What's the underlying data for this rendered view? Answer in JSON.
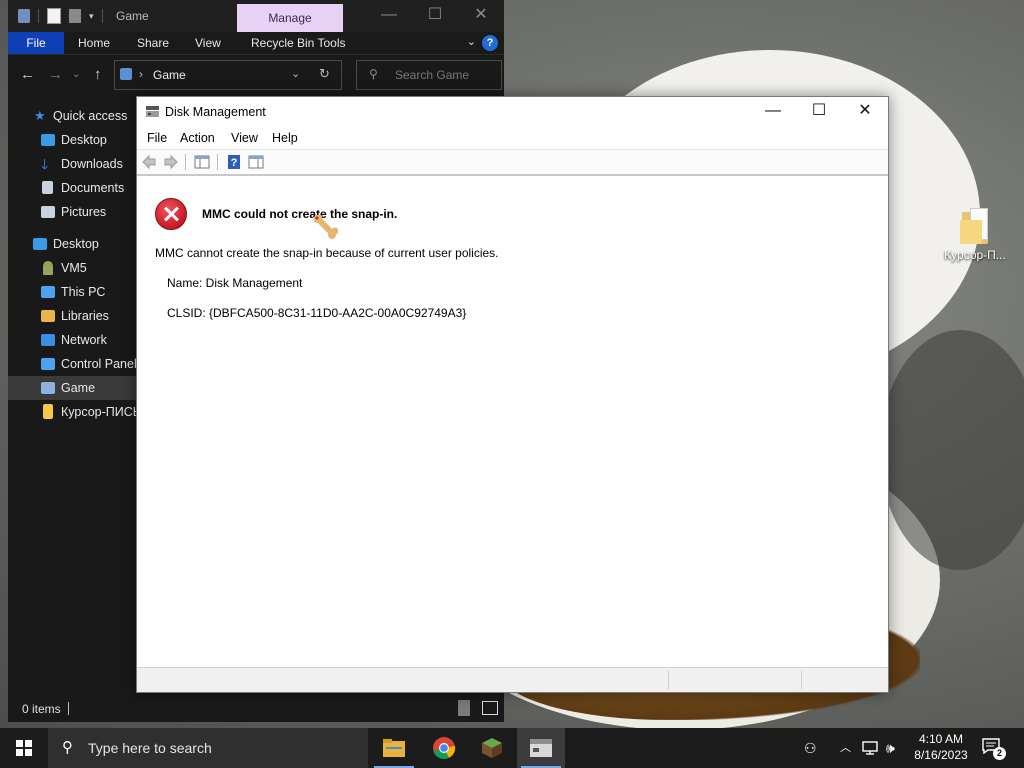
{
  "explorer": {
    "title": "Game",
    "context_tab": "Manage",
    "ribbon_tabs": [
      "File",
      "Home",
      "Share",
      "View",
      "Recycle Bin Tools"
    ],
    "address_crumb": "Game",
    "search_placeholder": "Search Game",
    "nav_items": [
      {
        "label": "Quick access",
        "icon": "star-icon",
        "color": "#3a8ee6"
      },
      {
        "label": "Desktop",
        "icon": "desktop-icon",
        "color": "#3a9be6"
      },
      {
        "label": "Downloads",
        "icon": "download-icon",
        "color": "#3a8ee6"
      },
      {
        "label": "Documents",
        "icon": "documents-icon",
        "color": "#c9d3df"
      },
      {
        "label": "Pictures",
        "icon": "pictures-icon",
        "color": "#c9d3df"
      },
      {
        "label": "Desktop",
        "icon": "desktop-icon",
        "color": "#3a9be6"
      },
      {
        "label": "VM5",
        "icon": "user-icon",
        "color": "#9aa05a"
      },
      {
        "label": "This PC",
        "icon": "computer-icon",
        "color": "#4aa3ef"
      },
      {
        "label": "Libraries",
        "icon": "libraries-icon",
        "color": "#e6b84a"
      },
      {
        "label": "Network",
        "icon": "network-icon",
        "color": "#3a8ee6"
      },
      {
        "label": "Control Panel",
        "icon": "control-panel-icon",
        "color": "#4aa3ef"
      },
      {
        "label": "Game",
        "icon": "recycle-bin-icon",
        "color": "#8fb0d8"
      },
      {
        "label": "Курсор-ПИСЬКА",
        "icon": "folder-icon",
        "color": "#f2c94c"
      }
    ],
    "status_count": "0 items"
  },
  "desktop": {
    "icon_label": "Курсор-П..."
  },
  "mmc": {
    "title": "Disk Management",
    "menu": [
      "File",
      "Action",
      "View",
      "Help"
    ],
    "error_heading": "MMC could not create the snap-in.",
    "error_message": "MMC cannot create the snap-in because of current user policies.",
    "name_line": "Name: Disk Management",
    "clsid_line": "CLSID: {DBFCA500-8C31-11D0-AA2C-00A0C92749A3}"
  },
  "taskbar": {
    "search_placeholder": "Type here to search",
    "apps": [
      "file-explorer-icon",
      "chrome-icon",
      "minecraft-icon",
      "mmc-icon"
    ],
    "time": "4:10 AM",
    "date": "8/16/2023",
    "notification_count": "2"
  },
  "colors": {
    "accent_blue": "#0f3fb5",
    "manage_tab": "#e6d2f5",
    "error_red": "#d0202c"
  }
}
